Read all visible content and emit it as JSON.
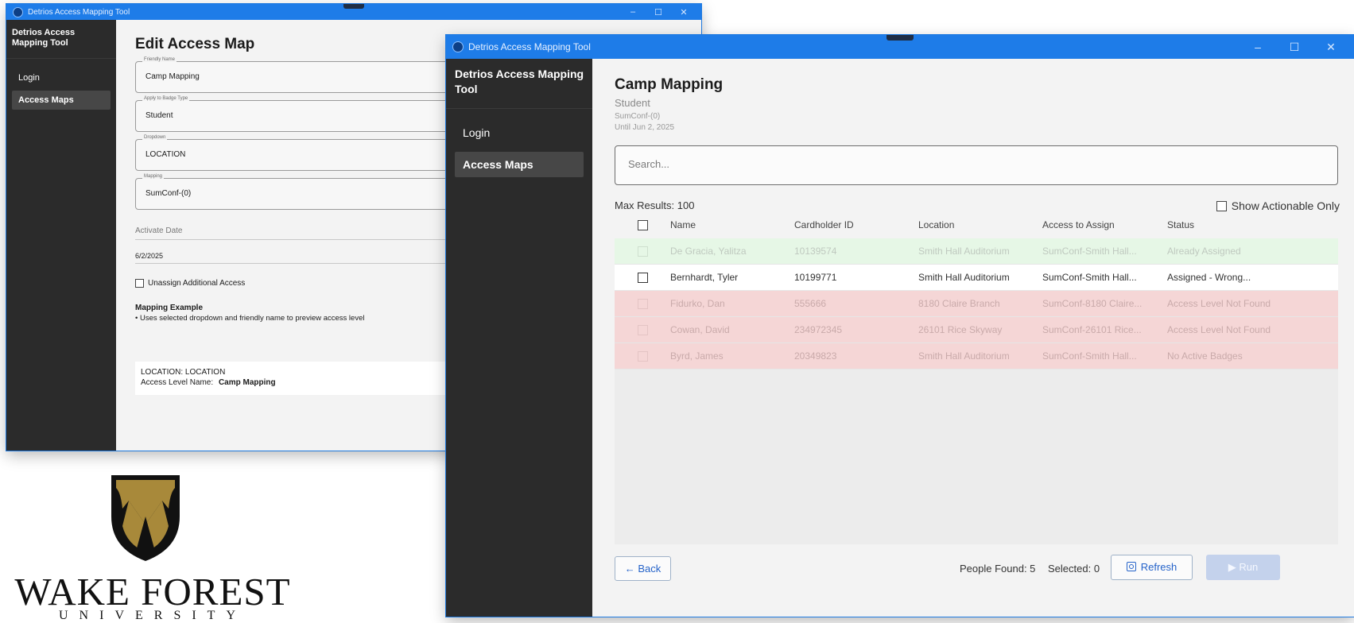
{
  "back_window": {
    "title": "Detrios Access Mapping Tool",
    "controls": {
      "minimize": "–",
      "maximize": "☐",
      "close": "✕"
    },
    "sidebar": {
      "title": "Detrios Access Mapping Tool",
      "items": [
        {
          "label": "Login"
        },
        {
          "label": "Access Maps"
        }
      ]
    },
    "heading": "Edit Access Map",
    "fields": [
      {
        "legend": "Friendly Name",
        "value": "Camp Mapping"
      },
      {
        "legend": "Apply to Badge Type",
        "value": "Student"
      },
      {
        "legend": "Dropdown",
        "value": "LOCATION"
      },
      {
        "legend": "Mapping",
        "value": "SumConf-(0)"
      }
    ],
    "activate_date": {
      "label": "Activate Date",
      "value": "6/2/2025"
    },
    "unassign_label": "Unassign Additional Access",
    "mapping_example": {
      "title": "Mapping Example",
      "bullet": "• Uses selected dropdown and friendly name to preview access level",
      "line1": "LOCATION: LOCATION",
      "line2_label": "Access Level Name:",
      "line2_value": "Camp Mapping"
    }
  },
  "front_window": {
    "title": "Detrios Access Mapping Tool",
    "controls": {
      "minimize": "–",
      "maximize": "☐",
      "close": "✕"
    },
    "sidebar": {
      "title": "Detrios Access Mapping Tool",
      "items": [
        {
          "label": "Login"
        },
        {
          "label": "Access Maps"
        }
      ]
    },
    "header": {
      "title": "Camp Mapping",
      "badge_type": "Student",
      "mapping": "SumConf-(0)",
      "until": "Until Jun 2, 2025"
    },
    "search": {
      "placeholder": "Search..."
    },
    "max_results": "Max Results: 100",
    "actionable_label": "Show Actionable Only",
    "columns": [
      "Name",
      "Cardholder ID",
      "Location",
      "Access to Assign",
      "Status"
    ],
    "rows": [
      {
        "name": "De Gracia, Yalitza",
        "id": "10139574",
        "location": "Smith Hall Auditorium",
        "access": "SumConf-Smith Hall...",
        "status": "Already Assigned",
        "tone": "green"
      },
      {
        "name": "Bernhardt, Tyler",
        "id": "10199771",
        "location": "Smith Hall Auditorium",
        "access": "SumConf-Smith Hall...",
        "status": "Assigned - Wrong...",
        "tone": "white"
      },
      {
        "name": "Fidurko, Dan",
        "id": "555666",
        "location": "8180 Claire Branch",
        "access": "SumConf-8180 Claire...",
        "status": "Access Level Not Found",
        "tone": "red"
      },
      {
        "name": "Cowan, David",
        "id": "234972345",
        "location": "26101 Rice Skyway",
        "access": "SumConf-26101 Rice...",
        "status": "Access Level Not Found",
        "tone": "red"
      },
      {
        "name": "Byrd, James",
        "id": "20349823",
        "location": "Smith Hall Auditorium",
        "access": "SumConf-Smith Hall...",
        "status": "No Active Badges",
        "tone": "red"
      }
    ],
    "footer": {
      "back_label": "← Back",
      "people_found": "People Found: 5",
      "selected": "Selected: 0",
      "refresh_label": "Refresh",
      "run_label": "▶ Run"
    }
  },
  "logo": {
    "wordmark": "WAKE FOREST",
    "subtitle": "UNIVERSITY"
  },
  "colors": {
    "titlebar": "#1e7ce8",
    "sidebar": "#2b2b2b",
    "row_green": "#e6f7e6",
    "row_red": "#f5d6d6",
    "accent": "#2563c9",
    "logo_gold": "#a8893a"
  }
}
